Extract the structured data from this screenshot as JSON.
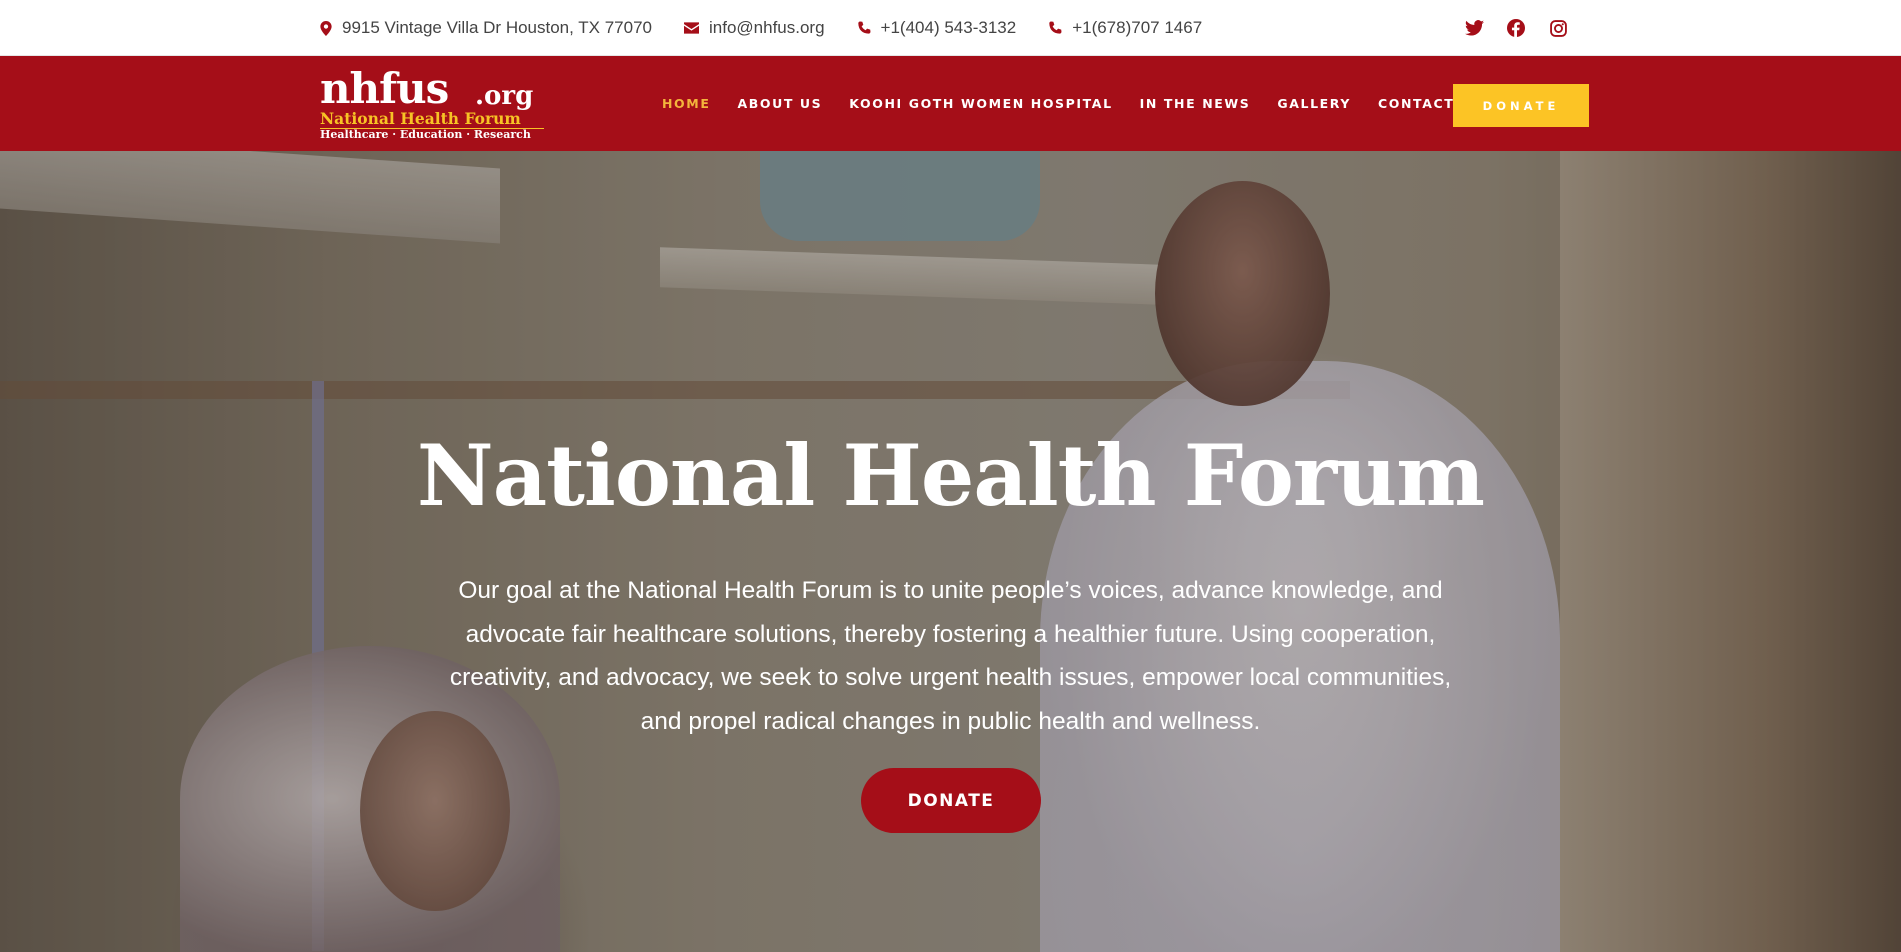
{
  "topbar": {
    "address": "9915 Vintage Villa Dr Houston, TX 77070",
    "email": "info@nhfus.org",
    "phone1": "+1(404) 543-3132",
    "phone2": "+1(678)707 1467",
    "icons": [
      "map-pin-icon",
      "envelope-icon",
      "phone-icon",
      "phone-icon",
      "twitter-icon",
      "facebook-icon",
      "instagram-icon"
    ]
  },
  "logo": {
    "main": "nhfus",
    "org": ".org",
    "tagline": "National Health Forum",
    "subline": "Healthcare · Education · Research"
  },
  "nav": {
    "items": [
      {
        "label": "HOME",
        "active": true
      },
      {
        "label": "ABOUT US",
        "active": false
      },
      {
        "label": "KOOHI GOTH WOMEN HOSPITAL",
        "active": false
      },
      {
        "label": "IN THE NEWS",
        "active": false
      },
      {
        "label": "GALLERY",
        "active": false
      },
      {
        "label": "CONTACT",
        "active": false
      }
    ],
    "donate_label": "DONATE"
  },
  "hero": {
    "title": "National Health Forum",
    "text": "Our goal at the National Health Forum is to unite people’s voices, advance knowledge, and advocate fair healthcare solutions, thereby fostering a healthier future. Using cooperation, creativity, and advocacy, we seek to solve urgent health issues, empower local communities, and propel radical changes in public health and wellness.",
    "donate_label": "DONATE"
  },
  "colors": {
    "brand_red": "#a50e18",
    "accent_yellow": "#fcc425",
    "active_nav": "#f3b43c"
  }
}
